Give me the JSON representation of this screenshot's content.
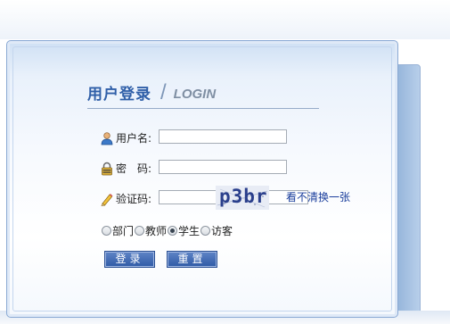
{
  "header": {
    "title_cn": "用户登录",
    "title_separator": "/",
    "title_en": "LOGIN"
  },
  "form": {
    "username": {
      "icon": "user-icon",
      "label": "用户名:",
      "value": ""
    },
    "password": {
      "icon": "lock-icon",
      "label": "密　码:",
      "value": ""
    },
    "captcha": {
      "icon": "pencil-icon",
      "label": "验证码:",
      "value": "",
      "image_text": "p3br",
      "refresh_link": "看不清换一张"
    },
    "roles": [
      {
        "label": "部门",
        "checked": false
      },
      {
        "label": "教师",
        "checked": false
      },
      {
        "label": "学生",
        "checked": true
      },
      {
        "label": "访客",
        "checked": false
      }
    ]
  },
  "buttons": {
    "login": "登录",
    "reset": "重置"
  },
  "colors": {
    "accent": "#2f5fa8",
    "button": "#3f6ab5",
    "link": "#1a3e9c"
  }
}
